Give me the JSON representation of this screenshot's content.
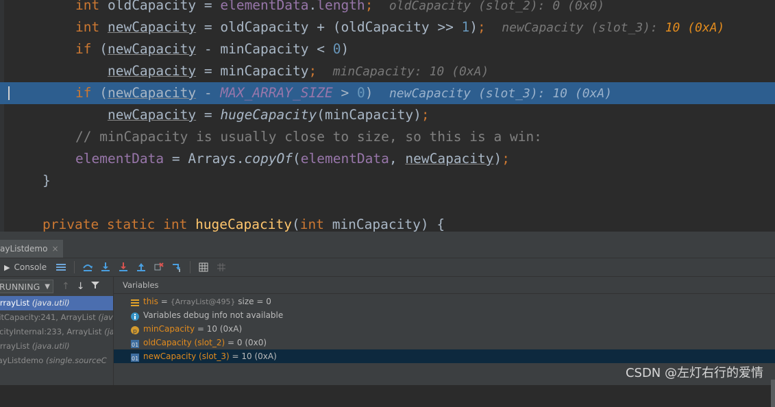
{
  "editor": {
    "lines": [
      {
        "id": "l1",
        "html": "<span class=\"kw\">int</span> oldCapacity = <span class=\"field\">elementData</span>.<span class=\"field\">length</span><span class=\"kw\">;</span>  <span class=\"hint\">oldCapacity (slot_2): 0 (0x0)</span>"
      },
      {
        "id": "l2",
        "html": "<span class=\"kw\">int</span> <span class=\"u\">newCapacity</span> = oldCapacity + (oldCapacity >> <span class=\"num\">1</span>)<span class=\"kw\">;</span>  <span class=\"hint\">newCapacity (slot_3): <span class=\"val\">10 (0xA)</span></span>"
      },
      {
        "id": "l3",
        "html": "<span class=\"kw\">if</span> (<span class=\"u\">newCapacity</span> - minCapacity < <span class=\"num\">0</span>)"
      },
      {
        "id": "l4",
        "html": "    <span class=\"u\">newCapacity</span> = minCapacity<span class=\"kw\">;</span>  <span class=\"hint\">minCapacity: 10 (0xA)</span>"
      },
      {
        "id": "l5",
        "html": "<span class=\"kw\">if</span> (<span class=\"u\">newCapacity</span> - <span class=\"sfield\">MAX_ARRAY_SIZE</span> > <span class=\"num\">0</span>)  <span class=\"hint\">newCapacity (slot_3): 10 (0xA)</span>"
      },
      {
        "id": "l6",
        "html": "    <span class=\"u\">newCapacity</span> = <span class=\"ital\">hugeCapacity</span>(minCapacity)<span class=\"kw\">;</span>"
      },
      {
        "id": "l7",
        "html": "<span class=\"cmt\">// minCapacity is usually close to size, so this is a win:</span>"
      },
      {
        "id": "l8",
        "html": "<span class=\"field\">elementData</span> = Arrays.<span class=\"ital\">copyOf</span>(<span class=\"field\">elementData</span>, <span class=\"u\">newCapacity</span>)<span class=\"kw\">;</span>"
      },
      {
        "id": "l9",
        "html": "}"
      },
      {
        "id": "l10",
        "html": ""
      },
      {
        "id": "l11",
        "html": "<span class=\"kw\">private static int</span> <span class=\"method\">hugeCapacity</span>(<span class=\"kw\">int</span> minCapacity) {"
      }
    ]
  },
  "tool": {
    "tab_label": "ayListdemo",
    "tab_close": "×",
    "console_label": "Console",
    "thread_state": "RUNNING",
    "vars_title": "Variables",
    "frames": [
      {
        "method": "ArrayList",
        "pkg": "(java.util)"
      },
      {
        "method": "citCapacity:241, ArrayList",
        "pkg": "(jav"
      },
      {
        "method": "acityInternal:233, ArrayList",
        "pkg": "(ja"
      },
      {
        "method": "ArrayList",
        "pkg": "(java.util)"
      },
      {
        "method": "rayListdemo",
        "pkg": "(single.sourceC"
      }
    ],
    "variables": [
      {
        "name": "this",
        "rest": " = ",
        "meta": "{ArrayList@495}",
        "extra": "  size = 0"
      },
      {
        "name": "",
        "rest": "Variables debug info not available",
        "meta": "",
        "extra": ""
      },
      {
        "name": "minCapacity",
        "rest": " = 10 (0xA)",
        "meta": "",
        "extra": ""
      },
      {
        "name": "oldCapacity (slot_2)",
        "rest": " = 0 (0x0)",
        "meta": "",
        "extra": ""
      },
      {
        "name": "newCapacity (slot_3)",
        "rest": " = 10 (0xA)",
        "meta": "",
        "extra": ""
      }
    ],
    "watermark": "CSDN @左灯右行的爱情"
  },
  "colors": {
    "current_line": "#2d5e8f",
    "selection": "#4b6eaf",
    "var_selected": "#0d293e"
  }
}
